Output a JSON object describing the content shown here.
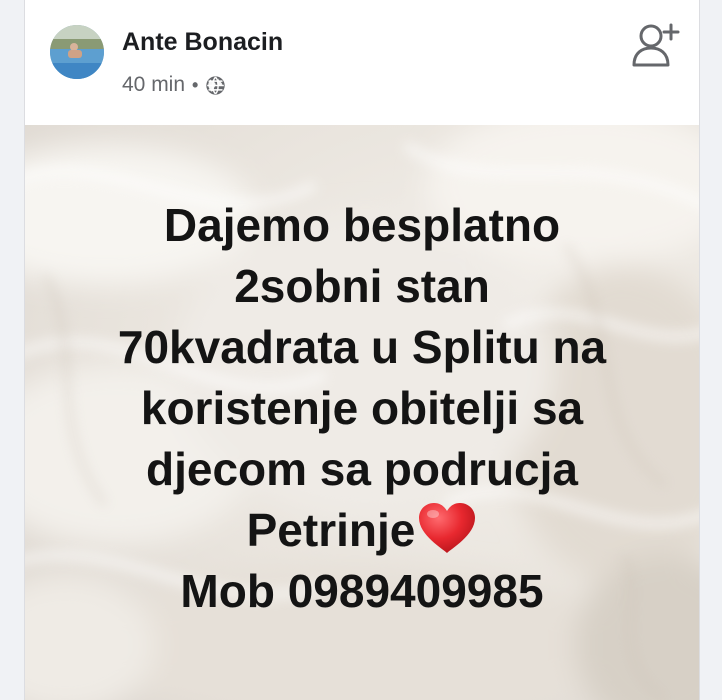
{
  "post": {
    "author_name": "Ante Bonacin",
    "timestamp": "40 min",
    "separator": "•",
    "privacy_icon": "globe-icon",
    "add_friend_icon": "add-friend-icon",
    "avatar_icon": "avatar-photo",
    "image_text": {
      "line1": "Dajemo besplatno",
      "line2": "2sobni stan",
      "line3": "70kvadrata u Splitu na",
      "line4": "koristenje obitelji sa",
      "line5": "djecom sa podrucja",
      "line6": "Petrinje",
      "line6_emoji": "red-heart-emoji",
      "line7": "Mob 0989409985"
    }
  },
  "colors": {
    "heart": "#e8282f",
    "text": "#141414",
    "meta": "#65676b",
    "background_image": "#e9e4dd"
  }
}
